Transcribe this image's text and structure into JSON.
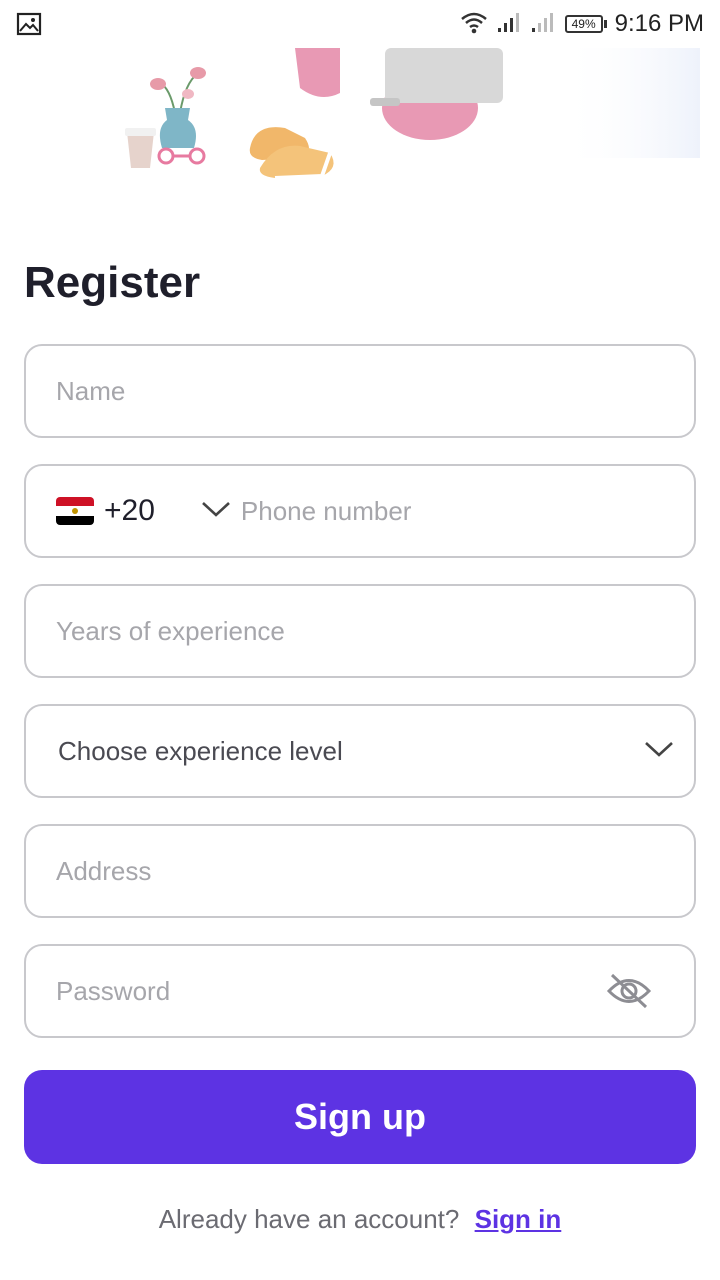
{
  "status_bar": {
    "time": "9:16 PM",
    "battery": "49%",
    "icons": [
      "gallery-icon",
      "wifi-icon",
      "signal-icon",
      "signal-icon-2",
      "battery-icon"
    ]
  },
  "illustration": {
    "subject": "woman-with-laptop-illustration"
  },
  "form": {
    "title": "Register",
    "name_placeholder": "Name",
    "country_code": "+20",
    "country_flag": "egypt-flag",
    "phone_placeholder": "Phone number",
    "years_placeholder": "Years of experience",
    "experience_level_label": "Choose experience level",
    "address_placeholder": "Address",
    "password_placeholder": "Password"
  },
  "actions": {
    "signup_label": "Sign up",
    "signin_question": "Already have an account?",
    "signin_link": "Sign in"
  },
  "colors": {
    "accent": "#5d33e3",
    "border": "#c8c8cc",
    "placeholder": "#a6a6ab"
  }
}
